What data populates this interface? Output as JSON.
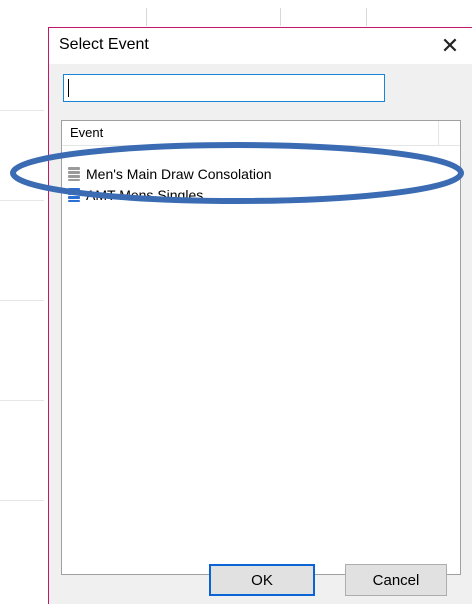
{
  "dialog": {
    "title": "Select Event",
    "close_glyph": "✕",
    "search": {
      "value": "",
      "placeholder": ""
    },
    "list": {
      "header": "Event",
      "items": [
        {
          "label": "Men's Main Draw Consolation",
          "icon": "event-grey-icon",
          "highlighted": true
        },
        {
          "label": "AMT Mens Singles",
          "icon": "event-blue-icon",
          "highlighted": false
        }
      ]
    },
    "buttons": {
      "ok": "OK",
      "cancel": "Cancel"
    }
  },
  "colors": {
    "accent": "#1883d7",
    "annotation": "#3b6cb3",
    "dialog_border": "#c2186b"
  }
}
